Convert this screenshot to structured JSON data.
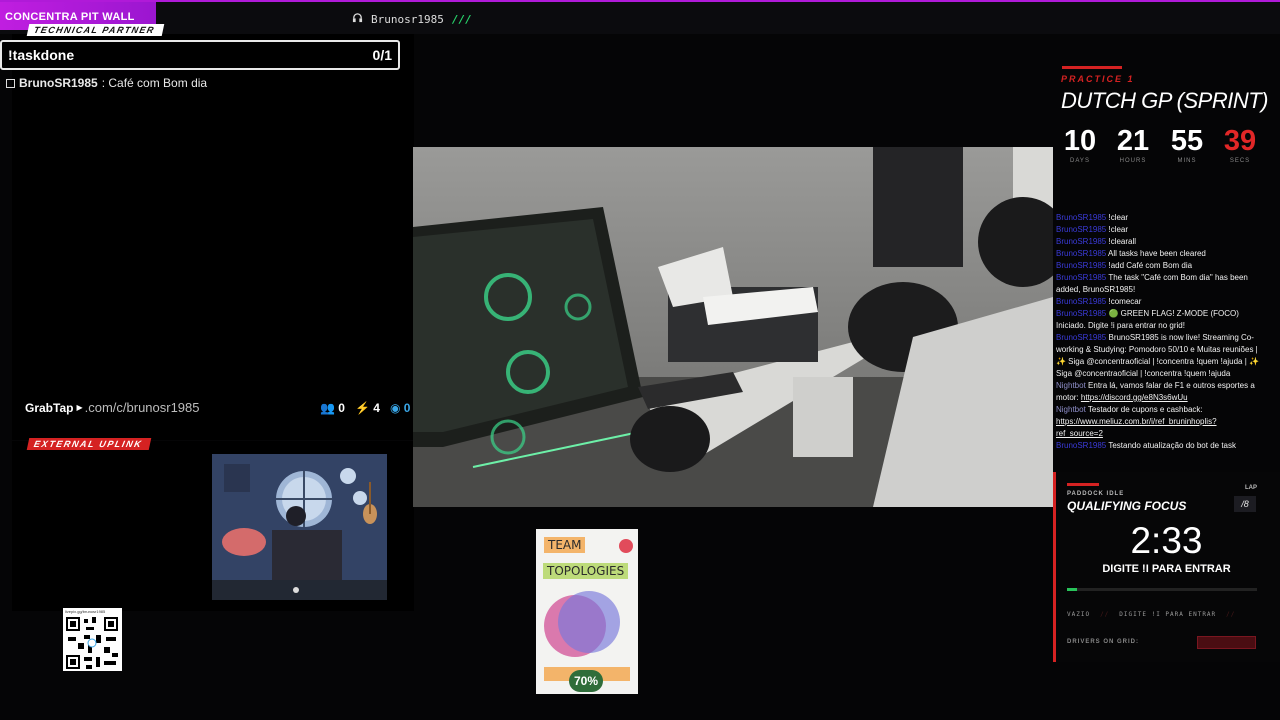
{
  "brand": {
    "label": "CONCENTRA PIT WALL"
  },
  "now_playing": {
    "channel": "Brunosr1985",
    "slashes": "///"
  },
  "tech_partner": {
    "label": "TECHNICAL PARTNER"
  },
  "task_panel": {
    "command": "!taskdone",
    "count": "0/1",
    "tasks": [
      {
        "user": "BrunoSR1985",
        "text": ": Café com Bom dia",
        "checked": false
      }
    ]
  },
  "grabtap": {
    "logo": "GrabTap",
    "url": ".com/c/brunosr1985",
    "viewers": "0",
    "bolts": "4",
    "live": "0"
  },
  "external_uplink": {
    "label": "EXTERNAL UPLINK"
  },
  "qr": {
    "url": "livepix.gg/brunosr1985"
  },
  "book": {
    "title_line1": "TEAM",
    "title_line2": "TOPOLOGIES",
    "progress_percent": 70,
    "progress_label": "70%"
  },
  "f1": {
    "session": "PRACTICE 1",
    "gp": "DUTCH GP (SPRINT)",
    "countdown": [
      {
        "value": "10",
        "label": "DAYS"
      },
      {
        "value": "21",
        "label": "HOURS"
      },
      {
        "value": "55",
        "label": "MINS"
      },
      {
        "value": "39",
        "label": "SECS"
      }
    ]
  },
  "chat": [
    {
      "user": "BrunoSR1985",
      "text": "!clear"
    },
    {
      "user": "BrunoSR1985",
      "text": "!clear"
    },
    {
      "user": "BrunoSR1985",
      "text": "!clearall"
    },
    {
      "user": "BrunoSR1985",
      "text": "All tasks have been cleared"
    },
    {
      "user": "BrunoSR1985",
      "text": "!add Café com Bom dia"
    },
    {
      "user": "BrunoSR1985",
      "text": "The task \"Café com Bom dia\" has been added, BrunoSR1985!"
    },
    {
      "user": "BrunoSR1985",
      "text": "!comecar"
    },
    {
      "user": "BrunoSR1985",
      "text": "🟢 GREEN FLAG! Z-MODE (FOCO) Iniciado. Digite !i para entrar no grid!"
    },
    {
      "user": "BrunoSR1985",
      "text": "BrunoSR1985 is now live! Streaming Co-working & Studying: Pomodoro 50/10 e Muitas reuniões | ✨ Siga @concentraoficial | !concentra !quem !ajuda | ✨ Siga @concentraoficial | !concentra !quem !ajuda"
    },
    {
      "user": "Nightbot",
      "text": "Entra lá, vamos falar de F1 e outros esportes a motor: ",
      "link": "https://discord.gg/e8N3s6wUu"
    },
    {
      "user": "Nightbot",
      "text": "Testador de cupons e cashback: ",
      "link": "https://www.meliuz.com.br/i/ref_bruninhoplis?ref_source=2"
    },
    {
      "user": "BrunoSR1985",
      "text": "Testando atualização do bot de task"
    }
  ],
  "qualifying": {
    "paddock": "PADDOCK IDLE",
    "lap_label": "LAP",
    "lap_value": "/8",
    "title": "QUALIFYING FOCUS",
    "time": "2:33",
    "hint": "DIGITE !I PARA ENTRAR",
    "progress": 0.05,
    "status_left": "VAZIO",
    "status_right": "DIGITE !I PARA ENTRAR",
    "drivers_label": "DRIVERS ON GRID:"
  },
  "colors": {
    "accent_red": "#d52222",
    "brand_purple": "#b01ad8",
    "green": "#28c35a"
  }
}
